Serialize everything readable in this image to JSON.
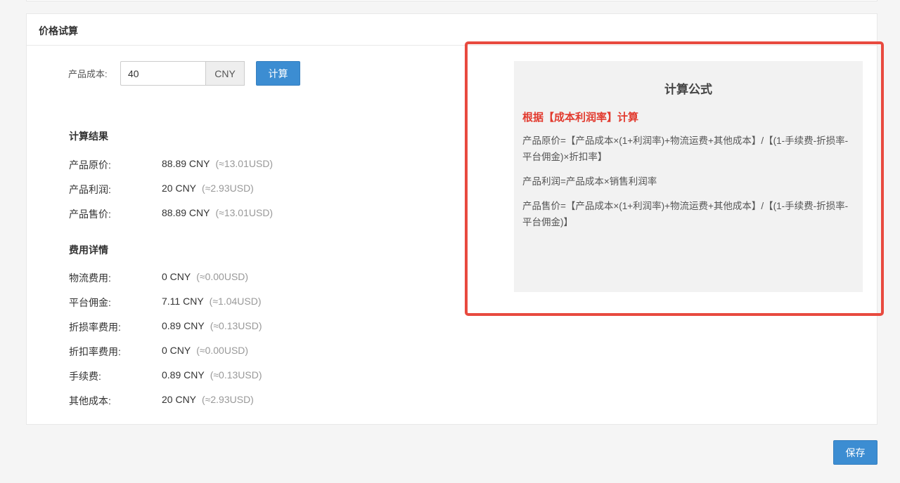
{
  "panel": {
    "title": "价格试算"
  },
  "cost": {
    "label": "产品成本:",
    "value": "40",
    "currency": "CNY",
    "calc_button": "计算"
  },
  "results": {
    "title": "计算结果",
    "rows": [
      {
        "label": "产品原价:",
        "value": "88.89 CNY",
        "usd": "(≈13.01USD)"
      },
      {
        "label": "产品利润:",
        "value": "20 CNY",
        "usd": "(≈2.93USD)"
      },
      {
        "label": "产品售价:",
        "value": "88.89 CNY",
        "usd": "(≈13.01USD)"
      }
    ]
  },
  "fees": {
    "title": "费用详情",
    "rows": [
      {
        "label": "物流费用:",
        "value": "0 CNY",
        "usd": "(≈0.00USD)"
      },
      {
        "label": "平台佣金:",
        "value": "7.11 CNY",
        "usd": "(≈1.04USD)"
      },
      {
        "label": "折损率费用:",
        "value": "0.89 CNY",
        "usd": "(≈0.13USD)"
      },
      {
        "label": "折扣率费用:",
        "value": "0 CNY",
        "usd": "(≈0.00USD)"
      },
      {
        "label": "手续费:",
        "value": "0.89 CNY",
        "usd": "(≈0.13USD)"
      },
      {
        "label": "其他成本:",
        "value": "20 CNY",
        "usd": "(≈2.93USD)"
      }
    ]
  },
  "formula": {
    "title": "计算公式",
    "subtitle": "根据【成本利润率】计算",
    "lines": [
      "产品原价=【产品成本×(1+利润率)+物流运费+其他成本】/【(1-手续费-折损率-平台佣金)×折扣率】",
      "产品利润=产品成本×销售利润率",
      "产品售价=【产品成本×(1+利润率)+物流运费+其他成本】/【(1-手续费-折损率-平台佣金)】"
    ]
  },
  "colors": {
    "primary": "#3c8dd2",
    "highlight": "#e84a3f",
    "formula_subtitle": "#e23a2e"
  },
  "footer": {
    "save_button": "保存"
  }
}
